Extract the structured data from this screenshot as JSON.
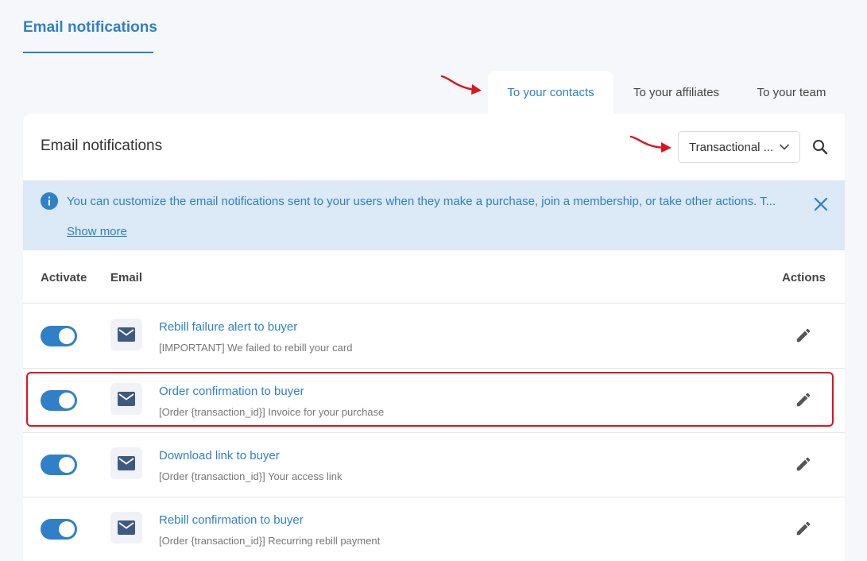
{
  "page": {
    "title": "Email notifications"
  },
  "tabs": [
    {
      "label": "To your contacts",
      "active": true
    },
    {
      "label": "To your affiliates",
      "active": false
    },
    {
      "label": "To your team",
      "active": false
    }
  ],
  "card": {
    "title": "Email notifications",
    "type_select": {
      "value": "Transactional ..."
    },
    "search_icon": "search-icon"
  },
  "banner": {
    "text": "You can customize the email notifications sent to your users when they make a purchase, join a membership, or take other actions. T...",
    "show_more": "Show more"
  },
  "table": {
    "headers": {
      "activate": "Activate",
      "email": "Email",
      "actions": "Actions"
    },
    "rows": [
      {
        "name": "Rebill failure alert to buyer",
        "subject": "[IMPORTANT] We failed to rebill your card",
        "active": true
      },
      {
        "name": "Order confirmation to buyer",
        "subject": "[Order {transaction_id}] Invoice for your purchase",
        "active": true
      },
      {
        "name": "Download link to buyer",
        "subject": "[Order {transaction_id}] Your access link",
        "active": true
      },
      {
        "name": "Rebill confirmation to buyer",
        "subject": "[Order {transaction_id}] Recurring rebill payment",
        "active": true
      }
    ]
  },
  "colors": {
    "accent": "#2f80c8",
    "annotation": "#e0121a",
    "banner_bg": "#dce9f6"
  }
}
